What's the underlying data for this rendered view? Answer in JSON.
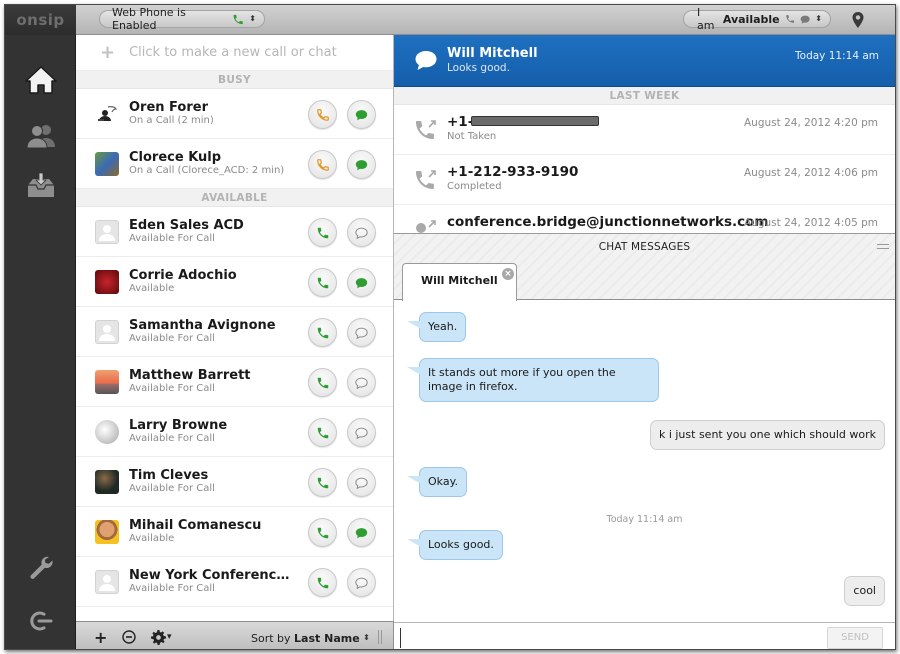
{
  "topbar": {
    "logo": "onsip",
    "webphone_label": "Web Phone is Enabled",
    "status_prefix": "I am",
    "status_value": "Available"
  },
  "colors": {
    "accent_blue": "#1a67b7",
    "call_green": "#2e9e32",
    "busy_orange": "#e29a2e",
    "incoming_bubble": "#cbe5f8",
    "outgoing_bubble": "#ededed"
  },
  "sidebar": {
    "items": [
      {
        "name": "home",
        "icon": "home-icon"
      },
      {
        "name": "contacts",
        "icon": "contacts-icon"
      },
      {
        "name": "inbox",
        "icon": "inbox-icon"
      },
      {
        "name": "settings",
        "icon": "wrench-icon"
      },
      {
        "name": "logout",
        "icon": "logout-icon"
      }
    ]
  },
  "contacts": {
    "new_call_placeholder": "Click to make a new call or chat",
    "groups": {
      "busy": "BUSY",
      "available": "AVAILABLE"
    },
    "busy": [
      {
        "name": "Oren Forer",
        "status": "On a Call (2 min)",
        "chat_active": true
      },
      {
        "name": "Clorece Kulp",
        "status": "On a Call (Clorece_ACD: 2 min)",
        "chat_active": true
      }
    ],
    "available": [
      {
        "name": "Eden Sales ACD",
        "status": "Available For Call",
        "chat_active": false
      },
      {
        "name": "Corrie Adochio",
        "status": "Available",
        "chat_active": true
      },
      {
        "name": "Samantha Avignone",
        "status": "Available For Call",
        "chat_active": false
      },
      {
        "name": "Matthew Barrett",
        "status": "Available For Call",
        "chat_active": false
      },
      {
        "name": "Larry Browne",
        "status": "Available For Call",
        "chat_active": false
      },
      {
        "name": "Tim Cleves",
        "status": "Available For Call",
        "chat_active": false
      },
      {
        "name": "Mihail Comanescu",
        "status": "Available",
        "chat_active": true
      },
      {
        "name": "New York Conference ...",
        "status": "Available For Call",
        "chat_active": false
      }
    ],
    "footer": {
      "sort_prefix": "Sort by",
      "sort_value": "Last Name"
    }
  },
  "active_call": {
    "name": "Will Mitchell",
    "last_message": "Looks good.",
    "time": "Today 11:14 am"
  },
  "recent": {
    "group": "LAST WEEK",
    "items": [
      {
        "name_prefix": "+1-",
        "redacted": true,
        "status": "Not Taken",
        "time": "August 24, 2012 4:20 pm"
      },
      {
        "name_prefix": "+1-212-933-9190",
        "redacted": false,
        "status": "Completed",
        "time": "August 24, 2012 4:06 pm"
      },
      {
        "name_prefix": "conference.bridge@junctionnetworks.com",
        "redacted": false,
        "status": "",
        "time": "August 24, 2012 4:05 pm"
      }
    ]
  },
  "chat": {
    "title": "CHAT MESSAGES",
    "tab_label": "Will Mitchell",
    "messages": [
      {
        "dir": "in",
        "text": "Yeah."
      },
      {
        "dir": "in",
        "text": "It stands out more if you open the image in firefox."
      },
      {
        "dir": "out",
        "text": "k i just sent you one which should work"
      },
      {
        "dir": "in",
        "text": "Okay."
      },
      {
        "dir": "in",
        "text": "Looks good."
      },
      {
        "dir": "out",
        "text": "cool"
      }
    ],
    "timestamp": "Today 11:14 am",
    "input_value": "",
    "send_label": "SEND"
  }
}
